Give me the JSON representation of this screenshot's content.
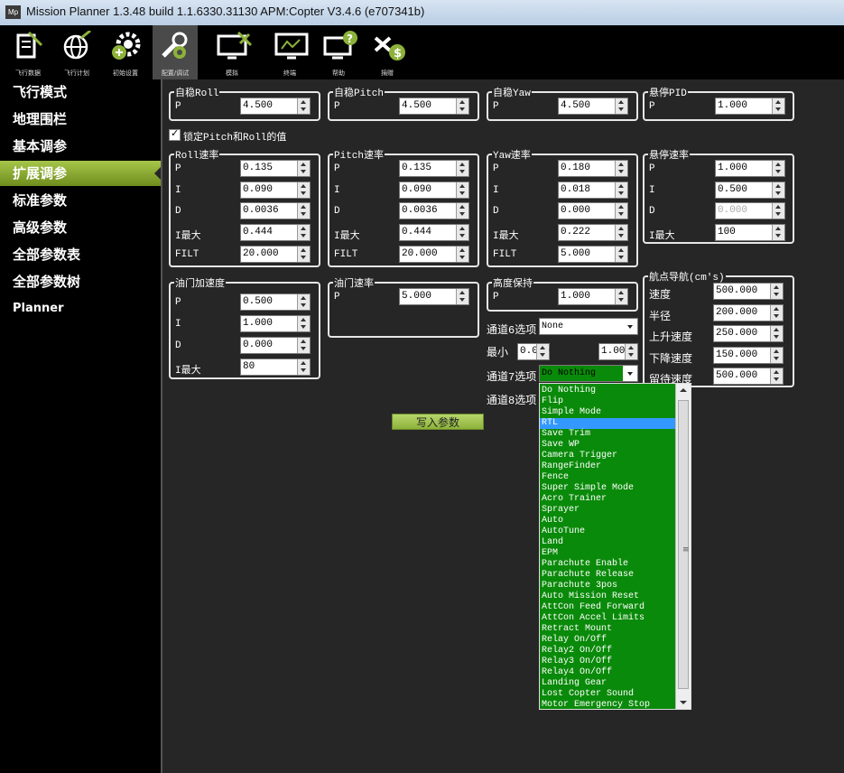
{
  "window": {
    "title": "Mission Planner 1.3.48 build 1.1.6330.31130 APM:Copter V3.4.6 (e707341b)",
    "icon_text": "Mp"
  },
  "toolbar": [
    {
      "label": "飞行数据",
      "icon": "flight-data-icon"
    },
    {
      "label": "飞行计划",
      "icon": "globe-icon"
    },
    {
      "label": "初始设置",
      "icon": "gear-plus-icon"
    },
    {
      "label": "配置/调试",
      "icon": "wrench-gear-icon"
    },
    {
      "label": "模拟",
      "icon": "monitor-plane-icon"
    },
    {
      "label": "终端",
      "icon": "terminal-icon"
    },
    {
      "label": "帮助",
      "icon": "help-icon"
    },
    {
      "label": "捐赠",
      "icon": "donate-icon"
    }
  ],
  "sidebar": [
    "飞行模式",
    "地理围栏",
    "基本调参",
    "扩展调参",
    "标准参数",
    "高级参数",
    "全部参数表",
    "全部参数树",
    "Planner"
  ],
  "groups": {
    "stab_roll": {
      "title": "自稳Roll",
      "p_label": "P",
      "p": "4.500"
    },
    "stab_pitch": {
      "title": "自稳Pitch",
      "p_label": "P",
      "p": "4.500"
    },
    "stab_yaw": {
      "title": "自稳Yaw",
      "p_label": "P",
      "p": "4.500"
    },
    "loiter_pid": {
      "title": "悬停PID",
      "p_label": "P",
      "p": "1.000"
    },
    "lock_checkbox": "锁定Pitch和Roll的值",
    "rate_roll": {
      "title": "Roll速率",
      "labels": [
        "P",
        "I",
        "D",
        "I最大",
        "FILT"
      ],
      "values": [
        "0.135",
        "0.090",
        "0.0036",
        "0.444",
        "20.000"
      ]
    },
    "rate_pitch": {
      "title": "Pitch速率",
      "labels": [
        "P",
        "I",
        "D",
        "I最大",
        "FILT"
      ],
      "values": [
        "0.135",
        "0.090",
        "0.0036",
        "0.444",
        "20.000"
      ]
    },
    "rate_yaw": {
      "title": "Yaw速率",
      "labels": [
        "P",
        "I",
        "D",
        "I最大",
        "FILT"
      ],
      "values": [
        "0.180",
        "0.018",
        "0.000",
        "0.222",
        "5.000"
      ]
    },
    "loiter_rate": {
      "title": "悬停速率",
      "labels": [
        "P",
        "I",
        "D",
        "I最大"
      ],
      "values": [
        "1.000",
        "0.500",
        "0.000",
        "100"
      ]
    },
    "throttle_accel": {
      "title": "油门加速度",
      "labels": [
        "P",
        "I",
        "D",
        "I最大"
      ],
      "values": [
        "0.500",
        "1.000",
        "0.000",
        "80"
      ]
    },
    "throttle_rate": {
      "title": "油门速率",
      "p_label": "P",
      "p": "5.000"
    },
    "alt_hold": {
      "title": "高度保持",
      "p_label": "P",
      "p": "1.000"
    },
    "wpnav": {
      "title": "航点导航(cm's)",
      "labels": [
        "速度",
        "半径",
        "上升速度",
        "下降速度",
        "留待速度"
      ],
      "values": [
        "500.000",
        "200.000",
        "250.000",
        "150.000",
        "500.000"
      ]
    }
  },
  "channels": {
    "ch6_label": "通道6选项",
    "ch6_value": "None",
    "min_label": "最小",
    "min_value": "0.000",
    "max_value": "1.000",
    "ch7_label": "通道7选项",
    "ch7_value": "Do Nothing",
    "ch8_label": "通道8选项"
  },
  "write_button": "写入参数",
  "dropdown_options": [
    "Do Nothing",
    "Flip",
    "Simple Mode",
    "RTL",
    "Save Trim",
    "Save WP",
    "Camera Trigger",
    "RangeFinder",
    "Fence",
    "Super Simple Mode",
    "Acro Trainer",
    "Sprayer",
    "Auto",
    "AutoTune",
    "Land",
    "EPM",
    "Parachute Enable",
    "Parachute Release",
    "Parachute 3pos",
    "Auto Mission Reset",
    "AttCon Feed Forward",
    "AttCon Accel Limits",
    "Retract Mount",
    "Relay On/Off",
    "Relay2 On/Off",
    "Relay3 On/Off",
    "Relay4 On/Off",
    "Landing Gear",
    "Lost Copter Sound",
    "Motor Emergency Stop"
  ],
  "dropdown_selected": "RTL",
  "colors": {
    "accent_green": "#8db23a",
    "dropdown_green": "#0a8a0a",
    "selection_blue": "#3399ff",
    "background": "#262626"
  }
}
